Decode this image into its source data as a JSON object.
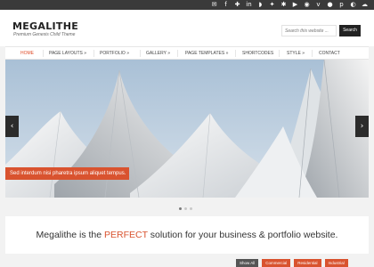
{
  "social_icons": [
    "mail-icon",
    "facebook-icon",
    "google-plus-icon",
    "linkedin-icon",
    "rss-icon",
    "stumbleupon-icon",
    "twitter-icon",
    "youtube-icon",
    "dribbble-icon",
    "vimeo-icon",
    "flickr-icon",
    "pinterest-icon",
    "github-icon",
    "email-icon"
  ],
  "header": {
    "title": "MEGALITHE",
    "description": "Premium Genesis Child Theme"
  },
  "search": {
    "placeholder": "Search this website ...",
    "button_label": "Search"
  },
  "nav": {
    "items": [
      {
        "label": "HOME",
        "active": true
      },
      {
        "label": "PAGE LAYOUTS »"
      },
      {
        "label": "PORTFOLIO »"
      },
      {
        "label": "GALLERY »"
      },
      {
        "label": "PAGE TEMPLATES »"
      },
      {
        "label": "SHORTCODES"
      },
      {
        "label": "STYLE »"
      },
      {
        "label": "CONTACT"
      }
    ]
  },
  "slider": {
    "caption": "Sed interdum nisi pharetra ipsum aliquet tempus.",
    "prev_label": "‹",
    "next_label": "›",
    "dot_count": 3,
    "active_dot": 1
  },
  "tagline": {
    "before": "Megalithe is the ",
    "accent": "PERFECT",
    "after": " solution for your business & portfolio website."
  },
  "portfolio_filters": {
    "items": [
      "Show All",
      "Commercial",
      "Residential",
      "Industrial"
    ]
  },
  "colors": {
    "accent": "#d9532f",
    "dark": "#2b2b2b"
  }
}
